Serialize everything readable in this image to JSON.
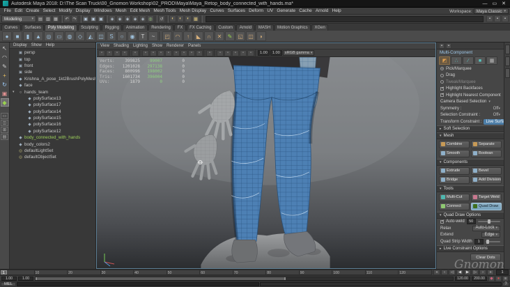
{
  "window": {
    "title": "Autodesk Maya 2018: D:\\The Scan Truck\\00_Gnomon Workshop\\02_PROD\\Maya\\Maya_Retop_body_connected_with_hands.ma*",
    "minimize": "—",
    "maximize": "▭",
    "close": "✕",
    "watermark": "Gnomon"
  },
  "menu_bar": {
    "items": [
      "File",
      "Edit",
      "Create",
      "Select",
      "Modify",
      "Display",
      "Windows",
      "Mesh",
      "Edit Mesh",
      "Mesh Tools",
      "Mesh Display",
      "Curves",
      "Surfaces",
      "Deform",
      "UV",
      "Generate",
      "Cache",
      "Arnold",
      "Help"
    ],
    "workspace_label": "Workspace:",
    "workspace_value": "Maya Classic"
  },
  "status_line": {
    "mode": "Modeling",
    "icons": [
      "new-scene",
      "open-scene",
      "save-scene",
      "sep",
      "undo",
      "redo",
      "sep",
      "select-by-hierarchy",
      "select-by-object",
      "select-by-component",
      "sep",
      "snap-grid",
      "snap-curve",
      "snap-point",
      "snap-projected-center",
      "snap-view-plane",
      "make-live",
      "sep",
      "construction-history",
      "sep",
      "open-render-view",
      "render-current-frame",
      "ipr-render",
      "render-settings",
      "sep"
    ],
    "right_icons": [
      "modeling-toolkit-toggle",
      "attribute-editor-toggle",
      "channel-box-toggle"
    ]
  },
  "shelf": {
    "tabs": [
      {
        "label": "Curves"
      },
      {
        "label": "Surfaces"
      },
      {
        "label": "Poly Modeling",
        "active": true
      },
      {
        "label": "Sculpting"
      },
      {
        "label": "Rigging"
      },
      {
        "label": "Animation"
      },
      {
        "label": "Rendering"
      },
      {
        "label": "FX"
      },
      {
        "label": "FX Caching"
      },
      {
        "label": "Custom"
      },
      {
        "label": "Arnold"
      },
      {
        "label": "MASH"
      },
      {
        "label": "Motion Graphics"
      },
      {
        "label": "XGen"
      }
    ],
    "icons": [
      "sphere",
      "cube",
      "cylinder",
      "cone",
      "torus",
      "plane",
      "disc",
      "platonic",
      "pyramid",
      "pipe",
      "helix",
      "soccer",
      "superellipse",
      "text",
      "curve-tool",
      "sep",
      "combine-shelf",
      "smooth-shelf",
      "extrude-shelf",
      "bevel-shelf",
      "bridge-shelf",
      "multicut-shelf",
      "quaddraw-shelf",
      "boolean-shelf",
      "mirror-shelf",
      "sculpt-shelf"
    ]
  },
  "toolbox": {
    "tools": [
      {
        "name": "select-tool"
      },
      {
        "name": "lasso-tool"
      },
      {
        "name": "paint-select-tool"
      },
      {
        "name": "move-tool"
      },
      {
        "name": "rotate-tool"
      },
      {
        "name": "scale-tool"
      },
      {
        "name": "quad-draw-tool",
        "active": true
      }
    ],
    "layouts": [
      "single-pane-layout",
      "two-pane-layout",
      "four-pane-layout",
      "outliner-persp-layout"
    ]
  },
  "outliner": {
    "menus": [
      "Display",
      "Show",
      "Help"
    ],
    "items": [
      {
        "label": "persp",
        "icon": "camera",
        "depth": 1
      },
      {
        "label": "top",
        "icon": "camera",
        "depth": 1
      },
      {
        "label": "front",
        "icon": "camera",
        "depth": 1
      },
      {
        "label": "side",
        "icon": "camera",
        "depth": 1
      },
      {
        "label": "Krishna_A_pose_1kt2BrushPolyMeshSD",
        "icon": "mesh",
        "depth": 1
      },
      {
        "label": "face",
        "icon": "mesh",
        "depth": 1
      },
      {
        "label": "hands_team",
        "icon": "group",
        "depth": 1,
        "expanded": true
      },
      {
        "label": "polySurface13",
        "icon": "mesh",
        "depth": 2
      },
      {
        "label": "polySurface17",
        "icon": "mesh",
        "depth": 2
      },
      {
        "label": "polySurface14",
        "icon": "mesh",
        "depth": 2
      },
      {
        "label": "polySurface15",
        "icon": "mesh",
        "depth": 2
      },
      {
        "label": "polySurface16",
        "icon": "mesh",
        "depth": 2
      },
      {
        "label": "polySurface12",
        "icon": "mesh",
        "depth": 2
      },
      {
        "label": "body_connected_with_hands",
        "icon": "mesh",
        "depth": 1,
        "state": "live"
      },
      {
        "label": "body_colors2",
        "icon": "mesh",
        "depth": 1
      },
      {
        "label": "defaultLightSet",
        "icon": "set",
        "depth": 1
      },
      {
        "label": "defaultObjectSet",
        "icon": "set",
        "depth": 1
      }
    ]
  },
  "viewport": {
    "menus": [
      "View",
      "Shading",
      "Lighting",
      "Show",
      "Renderer",
      "Panels"
    ],
    "toolbar_icons": [
      "select-camera",
      "lock-camera",
      "camera-attributes",
      "bookmark",
      "sep",
      "image-plane",
      "sep",
      "wireframe-mode",
      "smooth-shade-mode",
      "textured-mode",
      "use-all-lights",
      "shadows",
      "screen-space-ao",
      "motion-blur",
      "anti-alias",
      "sep",
      "isolate-select",
      "sep",
      "grid-toggle",
      "film-gate",
      "resolution-gate",
      "gate-mask",
      "safe-display",
      "sep"
    ],
    "exposure": "1.00",
    "gamma": "1.00",
    "colorspace": "sRGB gamma",
    "hud_rows": [
      {
        "label": "Verts:",
        "c1": "399825",
        "c2": "99007",
        "c3": "0"
      },
      {
        "label": "Edges:",
        "c1": "1201028",
        "c2": "297138",
        "c3": "0"
      },
      {
        "label": "Faces:",
        "c1": "800996",
        "c2": "198002",
        "c3": "0"
      },
      {
        "label": "Tris:",
        "c1": "1601734",
        "c2": "396004",
        "c3": "0"
      },
      {
        "label": "UVs:",
        "c1": "1879",
        "c2": "0",
        "c3": "0"
      }
    ]
  },
  "mtk": {
    "title": "Multi-Component",
    "mode_icons": [
      "multi-mode",
      "vertex-mode",
      "edge-mode",
      "face-mode",
      "uv-mode"
    ],
    "pick_marquee": "Pick/Marquee",
    "drag": "Drag",
    "tweak": "Tweak/Marquee",
    "hl_backfaces": "Highlight Backfaces",
    "hl_nearest": "Highlight Nearest Component",
    "camera_based": "Camera Based Selection",
    "symmetry_label": "Symmetry :",
    "symmetry_value": "Off",
    "sel_constraint_label": "Selection Constraint :",
    "sel_constraint_value": "Off",
    "xform_constraint_label": "Transform Constraint :",
    "xform_constraint_value": "Live Surface",
    "soft_selection": "Soft Selection",
    "mesh_title": "Mesh",
    "mesh_buttons": [
      {
        "label": "Combine",
        "icon": "combine"
      },
      {
        "label": "Separate",
        "icon": "separate"
      },
      {
        "label": "Smooth",
        "icon": "smooth"
      },
      {
        "label": "Boolean",
        "icon": "boolean"
      }
    ],
    "components_title": "Components",
    "component_buttons": [
      {
        "label": "Extrude",
        "icon": "extrude"
      },
      {
        "label": "Bevel",
        "icon": "bevel"
      },
      {
        "label": "Bridge",
        "icon": "bridge"
      },
      {
        "label": "Add Divisions",
        "icon": "add-divisions"
      }
    ],
    "tools_title": "Tools",
    "tool_buttons": [
      {
        "label": "Multi-Cut",
        "icon": "multi-cut"
      },
      {
        "label": "Target Weld",
        "icon": "target-weld"
      },
      {
        "label": "Connect",
        "icon": "connect"
      },
      {
        "label": "Quad Draw",
        "icon": "quad-draw",
        "active": true
      }
    ],
    "qd_title": "Quad Draw Options",
    "autoweld_label": "Auto-weld",
    "autoweld_value": "50",
    "relax_label": "Relax",
    "relax_value": "Auto-Lock",
    "extend_label": "Extend",
    "extend_value": "Edge",
    "strip_label": "Quad Strip Width",
    "strip_value": "1",
    "live_constraint_title": "Live Constraint Options",
    "clear_dots": "Clear Dots"
  },
  "timeline": {
    "ticks": [
      "1",
      "10",
      "20",
      "30",
      "40",
      "50",
      "60",
      "70",
      "80",
      "90",
      "100",
      "110",
      "120"
    ],
    "current": "1",
    "transport": [
      "go-to-start",
      "prev-key",
      "step-back",
      "play-backward",
      "play-forward",
      "step-forward",
      "next-key",
      "go-to-end"
    ]
  },
  "range_slider": {
    "outer_start": "1.00",
    "inner_start": "1.00",
    "inner_end": "120.00",
    "outer_end": "200.00",
    "icons": [
      "set-key",
      "auto-key",
      "anim-prefs"
    ]
  },
  "command_line": {
    "label": "MEL"
  }
}
